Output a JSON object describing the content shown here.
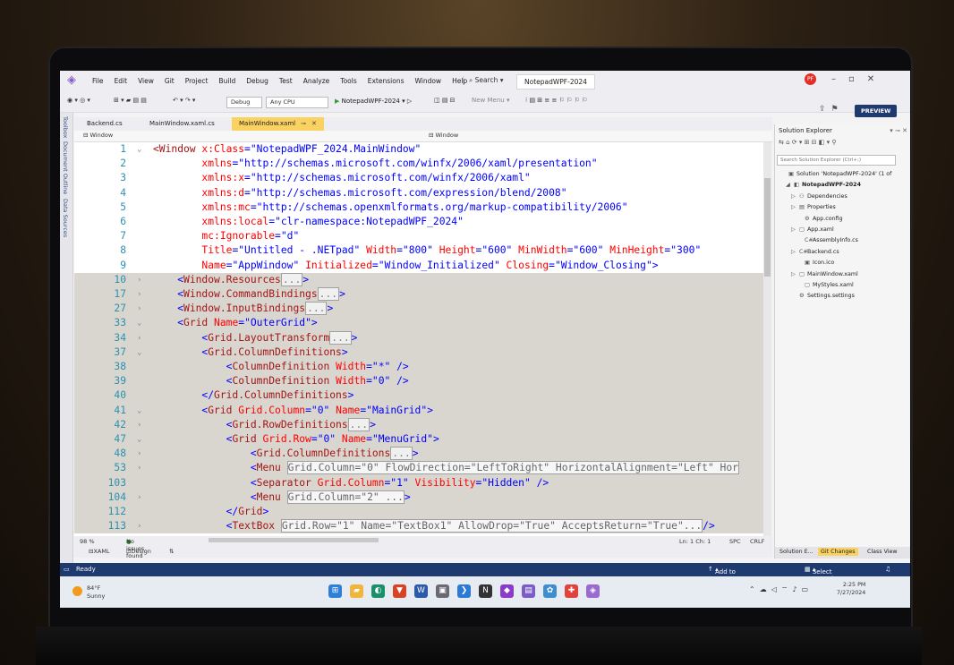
{
  "titlebar": {
    "menu": [
      "File",
      "Edit",
      "View",
      "Git",
      "Project",
      "Build",
      "Debug",
      "Test",
      "Analyze",
      "Tools",
      "Extensions",
      "Window",
      "Help"
    ],
    "search_label": "Search",
    "solution_name": "NotepadWPF-2024",
    "account_initials": "PF",
    "preview_label": "PREVIEW"
  },
  "toolbar": {
    "config": "Debug",
    "platform": "Any CPU",
    "run_target": "NotepadWPF-2024",
    "new_menu": "New Menu"
  },
  "left_tabs": [
    "Toolbox",
    "Document Outline",
    "Data Sources"
  ],
  "doc_tabs": [
    {
      "label": "Backend.cs"
    },
    {
      "label": "MainWindow.xaml.cs"
    },
    {
      "label": "MainWindow.xaml"
    }
  ],
  "navbar": {
    "left": "Window",
    "right": "Window"
  },
  "editor_lines": [
    {
      "n": "1",
      "fold": "⌄",
      "segs": [
        [
          "el",
          "<Window "
        ],
        [
          "at",
          "x:Class"
        ],
        [
          "pun",
          "="
        ],
        [
          "val",
          "\"NotepadWPF_2024.MainWindow\""
        ]
      ]
    },
    {
      "n": "2",
      "fold": "",
      "segs": [
        [
          "sp",
          "        "
        ],
        [
          "at",
          "xmlns"
        ],
        [
          "pun",
          "="
        ],
        [
          "val",
          "\"http://schemas.microsoft.com/winfx/2006/xaml/presentation\""
        ]
      ]
    },
    {
      "n": "3",
      "fold": "",
      "segs": [
        [
          "sp",
          "        "
        ],
        [
          "at",
          "xmlns:x"
        ],
        [
          "pun",
          "="
        ],
        [
          "val",
          "\"http://schemas.microsoft.com/winfx/2006/xaml\""
        ]
      ]
    },
    {
      "n": "4",
      "fold": "",
      "segs": [
        [
          "sp",
          "        "
        ],
        [
          "at",
          "xmlns:d"
        ],
        [
          "pun",
          "="
        ],
        [
          "val",
          "\"http://schemas.microsoft.com/expression/blend/2008\""
        ]
      ]
    },
    {
      "n": "5",
      "fold": "",
      "segs": [
        [
          "sp",
          "        "
        ],
        [
          "at",
          "xmlns:mc"
        ],
        [
          "pun",
          "="
        ],
        [
          "val",
          "\"http://schemas.openxmlformats.org/markup-compatibility/2006\""
        ]
      ]
    },
    {
      "n": "6",
      "fold": "",
      "segs": [
        [
          "sp",
          "        "
        ],
        [
          "at",
          "xmlns:local"
        ],
        [
          "pun",
          "="
        ],
        [
          "val",
          "\"clr-namespace:NotepadWPF_2024\""
        ]
      ]
    },
    {
      "n": "7",
      "fold": "",
      "segs": [
        [
          "sp",
          "        "
        ],
        [
          "at",
          "mc:Ignorable"
        ],
        [
          "pun",
          "="
        ],
        [
          "val",
          "\"d\""
        ]
      ]
    },
    {
      "n": "8",
      "fold": "",
      "segs": [
        [
          "sp",
          "        "
        ],
        [
          "at",
          "Title"
        ],
        [
          "pun",
          "="
        ],
        [
          "val",
          "\"Untitled - .NETpad\" "
        ],
        [
          "at",
          "Width"
        ],
        [
          "pun",
          "="
        ],
        [
          "val",
          "\"800\" "
        ],
        [
          "at",
          "Height"
        ],
        [
          "pun",
          "="
        ],
        [
          "val",
          "\"600\" "
        ],
        [
          "at",
          "MinWidth"
        ],
        [
          "pun",
          "="
        ],
        [
          "val",
          "\"600\" "
        ],
        [
          "at",
          "MinHeight"
        ],
        [
          "pun",
          "="
        ],
        [
          "val",
          "\"300\""
        ]
      ]
    },
    {
      "n": "9",
      "fold": "",
      "segs": [
        [
          "sp",
          "        "
        ],
        [
          "at",
          "Name"
        ],
        [
          "pun",
          "="
        ],
        [
          "val",
          "\"AppWindow\" "
        ],
        [
          "at",
          "Initialized"
        ],
        [
          "pun",
          "="
        ],
        [
          "val",
          "\"Window_Initialized\" "
        ],
        [
          "at",
          "Closing"
        ],
        [
          "pun",
          "="
        ],
        [
          "val",
          "\"Window_Closing\""
        ],
        [
          "pun",
          ">"
        ]
      ]
    },
    {
      "n": "10",
      "fold": "›",
      "shaded": true,
      "segs": [
        [
          "sp",
          "    "
        ],
        [
          "pun",
          "<"
        ],
        [
          "el",
          "Window.Resources"
        ],
        [
          "coll",
          "..."
        ],
        [
          "pun",
          ">"
        ]
      ]
    },
    {
      "n": "17",
      "fold": "›",
      "shaded": true,
      "segs": [
        [
          "sp",
          "    "
        ],
        [
          "pun",
          "<"
        ],
        [
          "el",
          "Window.CommandBindings"
        ],
        [
          "coll",
          "..."
        ],
        [
          "pun",
          ">"
        ]
      ]
    },
    {
      "n": "27",
      "fold": "›",
      "shaded": true,
      "segs": [
        [
          "sp",
          "    "
        ],
        [
          "pun",
          "<"
        ],
        [
          "el",
          "Window.InputBindings"
        ],
        [
          "coll",
          "..."
        ],
        [
          "pun",
          ">"
        ]
      ]
    },
    {
      "n": "33",
      "fold": "⌄",
      "shaded": true,
      "segs": [
        [
          "sp",
          "    "
        ],
        [
          "pun",
          "<"
        ],
        [
          "el",
          "Grid "
        ],
        [
          "at",
          "Name"
        ],
        [
          "pun",
          "="
        ],
        [
          "val",
          "\"OuterGrid\""
        ],
        [
          "pun",
          ">"
        ]
      ]
    },
    {
      "n": "34",
      "fold": "›",
      "shaded": true,
      "segs": [
        [
          "sp",
          "        "
        ],
        [
          "pun",
          "<"
        ],
        [
          "el",
          "Grid.LayoutTransform"
        ],
        [
          "coll",
          "..."
        ],
        [
          "pun",
          ">"
        ]
      ]
    },
    {
      "n": "37",
      "fold": "⌄",
      "shaded": true,
      "segs": [
        [
          "sp",
          "        "
        ],
        [
          "pun",
          "<"
        ],
        [
          "el",
          "Grid.ColumnDefinitions"
        ],
        [
          "pun",
          ">"
        ]
      ]
    },
    {
      "n": "38",
      "fold": "",
      "shaded": true,
      "segs": [
        [
          "sp",
          "            "
        ],
        [
          "pun",
          "<"
        ],
        [
          "el",
          "ColumnDefinition "
        ],
        [
          "at",
          "Width"
        ],
        [
          "pun",
          "="
        ],
        [
          "val",
          "\"*\" "
        ],
        [
          "pun",
          "/>"
        ]
      ]
    },
    {
      "n": "39",
      "fold": "",
      "shaded": true,
      "segs": [
        [
          "sp",
          "            "
        ],
        [
          "pun",
          "<"
        ],
        [
          "el",
          "ColumnDefinition "
        ],
        [
          "at",
          "Width"
        ],
        [
          "pun",
          "="
        ],
        [
          "val",
          "\"0\" "
        ],
        [
          "pun",
          "/>"
        ]
      ]
    },
    {
      "n": "40",
      "fold": "",
      "shaded": true,
      "segs": [
        [
          "sp",
          "        "
        ],
        [
          "pun",
          "</"
        ],
        [
          "el",
          "Grid.ColumnDefinitions"
        ],
        [
          "pun",
          ">"
        ]
      ]
    },
    {
      "n": "41",
      "fold": "⌄",
      "shaded": true,
      "segs": [
        [
          "sp",
          "        "
        ],
        [
          "pun",
          "<"
        ],
        [
          "el",
          "Grid "
        ],
        [
          "at",
          "Grid.Column"
        ],
        [
          "pun",
          "="
        ],
        [
          "val",
          "\"0\" "
        ],
        [
          "at",
          "Name"
        ],
        [
          "pun",
          "="
        ],
        [
          "val",
          "\"MainGrid\""
        ],
        [
          "pun",
          ">"
        ]
      ]
    },
    {
      "n": "42",
      "fold": "›",
      "shaded": true,
      "segs": [
        [
          "sp",
          "            "
        ],
        [
          "pun",
          "<"
        ],
        [
          "el",
          "Grid.RowDefinitions"
        ],
        [
          "coll",
          "..."
        ],
        [
          "pun",
          ">"
        ]
      ]
    },
    {
      "n": "47",
      "fold": "⌄",
      "shaded": true,
      "segs": [
        [
          "sp",
          "            "
        ],
        [
          "pun",
          "<"
        ],
        [
          "el",
          "Grid "
        ],
        [
          "at",
          "Grid.Row"
        ],
        [
          "pun",
          "="
        ],
        [
          "val",
          "\"0\" "
        ],
        [
          "at",
          "Name"
        ],
        [
          "pun",
          "="
        ],
        [
          "val",
          "\"MenuGrid\""
        ],
        [
          "pun",
          ">"
        ]
      ]
    },
    {
      "n": "48",
      "fold": "›",
      "shaded": true,
      "segs": [
        [
          "sp",
          "                "
        ],
        [
          "pun",
          "<"
        ],
        [
          "el",
          "Grid.ColumnDefinitions"
        ],
        [
          "coll",
          "..."
        ],
        [
          "pun",
          ">"
        ]
      ]
    },
    {
      "n": "53",
      "fold": "›",
      "shaded": true,
      "segs": [
        [
          "sp",
          "                "
        ],
        [
          "pun",
          "<"
        ],
        [
          "el",
          "Menu "
        ],
        [
          "ovl",
          "Grid.Column=\"0\" FlowDirection=\"LeftToRight\" HorizontalAlignment=\"Left\" Hor"
        ]
      ]
    },
    {
      "n": "103",
      "fold": "",
      "shaded": true,
      "segs": [
        [
          "sp",
          "                "
        ],
        [
          "pun",
          "<"
        ],
        [
          "el",
          "Separator "
        ],
        [
          "at",
          "Grid.Column"
        ],
        [
          "pun",
          "="
        ],
        [
          "val",
          "\"1\" "
        ],
        [
          "at",
          "Visibility"
        ],
        [
          "pun",
          "="
        ],
        [
          "val",
          "\"Hidden\" "
        ],
        [
          "pun",
          "/>"
        ]
      ]
    },
    {
      "n": "104",
      "fold": "›",
      "shaded": true,
      "segs": [
        [
          "sp",
          "                "
        ],
        [
          "pun",
          "<"
        ],
        [
          "el",
          "Menu "
        ],
        [
          "ovl",
          "Grid.Column=\"2\" ..."
        ],
        [
          "pun",
          ">"
        ]
      ]
    },
    {
      "n": "112",
      "fold": "",
      "shaded": true,
      "segs": [
        [
          "sp",
          "            "
        ],
        [
          "pun",
          "</"
        ],
        [
          "el",
          "Grid"
        ],
        [
          "pun",
          ">"
        ]
      ]
    },
    {
      "n": "113",
      "fold": "›",
      "shaded": true,
      "segs": [
        [
          "sp",
          "            "
        ],
        [
          "pun",
          "<"
        ],
        [
          "el",
          "TextBox "
        ],
        [
          "ovl",
          "Grid.Row=\"1\" Name=\"TextBox1\" AllowDrop=\"True\" AcceptsReturn=\"True\"..."
        ],
        [
          "pun",
          "/>"
        ]
      ]
    }
  ],
  "editor_status": {
    "zoom": "98 %",
    "issues": "No issues found",
    "position": "Ln: 1   Ch: 1",
    "spc": "SPC",
    "crlf": "CRLF",
    "xaml_tab": "XAML",
    "design_tab": "Design"
  },
  "solution_explorer": {
    "title": "Solution Explorer",
    "search_placeholder": "Search Solution Explorer (Ctrl+;)",
    "items": [
      {
        "label": "Solution 'NotepadWPF-2024' (1 of",
        "icon": "▣",
        "indent": 0
      },
      {
        "label": "NotepadWPF-2024",
        "icon": "◧",
        "indent": 1,
        "bold": true
      },
      {
        "label": "Dependencies",
        "icon": "⚇",
        "indent": 2
      },
      {
        "label": "Properties",
        "icon": "▤",
        "indent": 2
      },
      {
        "label": "App.config",
        "icon": "⚙",
        "indent": 3
      },
      {
        "label": "App.xaml",
        "icon": "▢",
        "indent": 2
      },
      {
        "label": "AssemblyInfo.cs",
        "icon": "C#",
        "indent": 3
      },
      {
        "label": "Backend.cs",
        "icon": "C#",
        "indent": 2
      },
      {
        "label": "Icon.ico",
        "icon": "▣",
        "indent": 3
      },
      {
        "label": "MainWindow.xaml",
        "icon": "▢",
        "indent": 2
      },
      {
        "label": "MyStyles.xaml",
        "icon": "▢",
        "indent": 3
      },
      {
        "label": "Settings.settings",
        "icon": "⚙",
        "indent": 2
      }
    ],
    "tabs": [
      "Solution E...",
      "Git Changes",
      "Class View"
    ]
  },
  "statusbar": {
    "ready": "Ready",
    "add_source": "Add to Source Control",
    "select_repo": "Select Repository"
  },
  "taskbar": {
    "temp": "84°F",
    "condition": "Sunny",
    "time": "2:25 PM",
    "date": "7/27/2024"
  }
}
